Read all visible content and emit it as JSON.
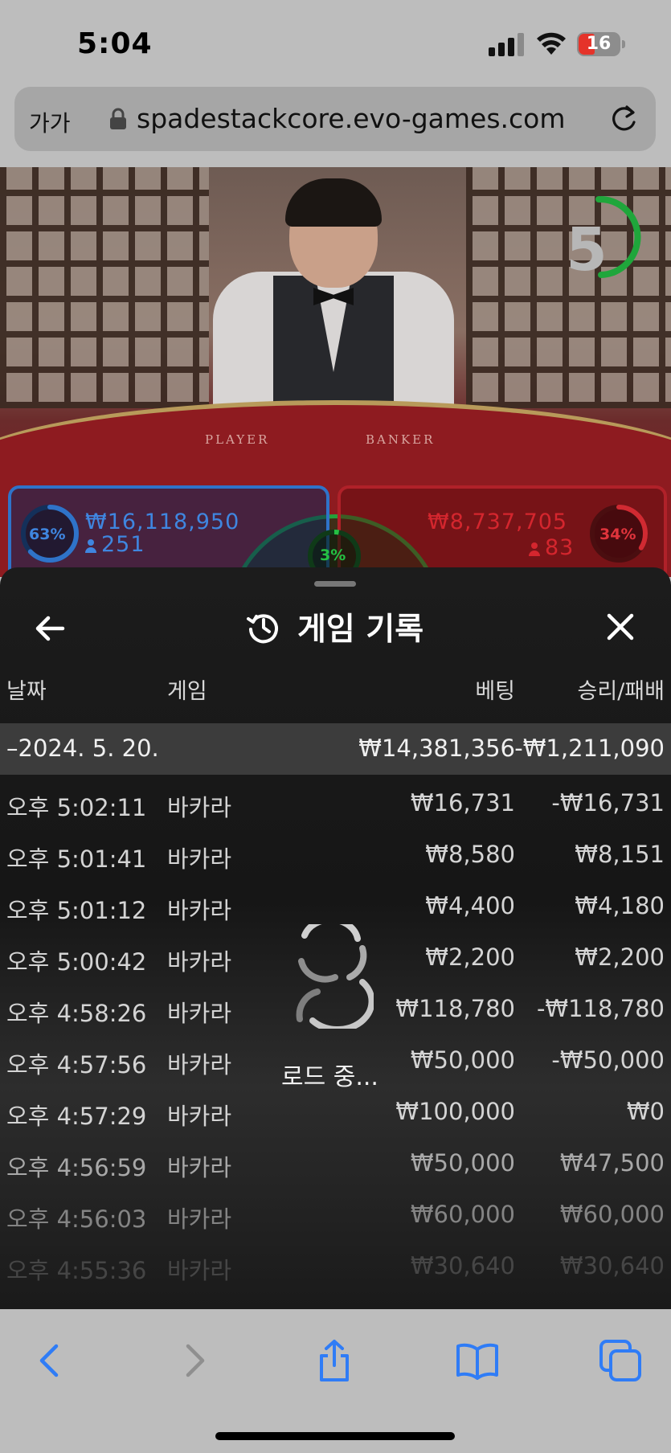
{
  "status_bar": {
    "time": "5:04",
    "battery_level": "16",
    "signal_bars": 3,
    "battery_color": "#e5332a"
  },
  "browser": {
    "text_size_label": "가가",
    "url": "spadestackcore.evo-games.com",
    "icons": [
      "lock-icon",
      "reload-icon",
      "back-icon",
      "forward-icon",
      "share-icon",
      "bookmarks-icon",
      "tabs-icon"
    ],
    "accent": "#2f7cf6"
  },
  "game": {
    "countdown": "5",
    "table_labels": {
      "player": "PLAYER",
      "banker": "BANKER"
    },
    "player": {
      "percent": "63%",
      "amount": "₩16,118,950",
      "players": "251",
      "color": "#2f73c9",
      "fraction": 0.63
    },
    "banker": {
      "percent": "34%",
      "amount": "₩8,737,705",
      "players": "83",
      "color": "#c22028",
      "fraction": 0.34
    },
    "tie": {
      "percent": "3%",
      "color": "#25a13a",
      "fraction": 0.03
    }
  },
  "history": {
    "title": "게임 기록",
    "columns": {
      "date": "날짜",
      "game": "게임",
      "bet": "베팅",
      "result": "승리/패배"
    },
    "day": {
      "date": "–2024. 5. 20.",
      "bet_total": "₩14,381,356",
      "result_total": "-₩1,211,090"
    },
    "rows": [
      {
        "time": "오후 5:02:11",
        "game": "바카라",
        "bet": "₩16,731",
        "result": "-₩16,731"
      },
      {
        "time": "오후 5:01:41",
        "game": "바카라",
        "bet": "₩8,580",
        "result": "₩8,151"
      },
      {
        "time": "오후 5:01:12",
        "game": "바카라",
        "bet": "₩4,400",
        "result": "₩4,180"
      },
      {
        "time": "오후 5:00:42",
        "game": "바카라",
        "bet": "₩2,200",
        "result": "₩2,200"
      },
      {
        "time": "오후 4:58:26",
        "game": "바카라",
        "bet": "₩118,780",
        "result": "-₩118,780"
      },
      {
        "time": "오후 4:57:56",
        "game": "바카라",
        "bet": "₩50,000",
        "result": "-₩50,000"
      },
      {
        "time": "오후 4:57:29",
        "game": "바카라",
        "bet": "₩100,000",
        "result": "₩0"
      },
      {
        "time": "오후 4:56:59",
        "game": "바카라",
        "bet": "₩50,000",
        "result": "₩47,500"
      },
      {
        "time": "오후 4:56:03",
        "game": "바카라",
        "bet": "₩60,000",
        "result": "₩60,000"
      },
      {
        "time": "오후 4:55:36",
        "game": "바카라",
        "bet": "₩30,640",
        "result": "₩30,640"
      }
    ],
    "loading_text": "로드 중..."
  }
}
